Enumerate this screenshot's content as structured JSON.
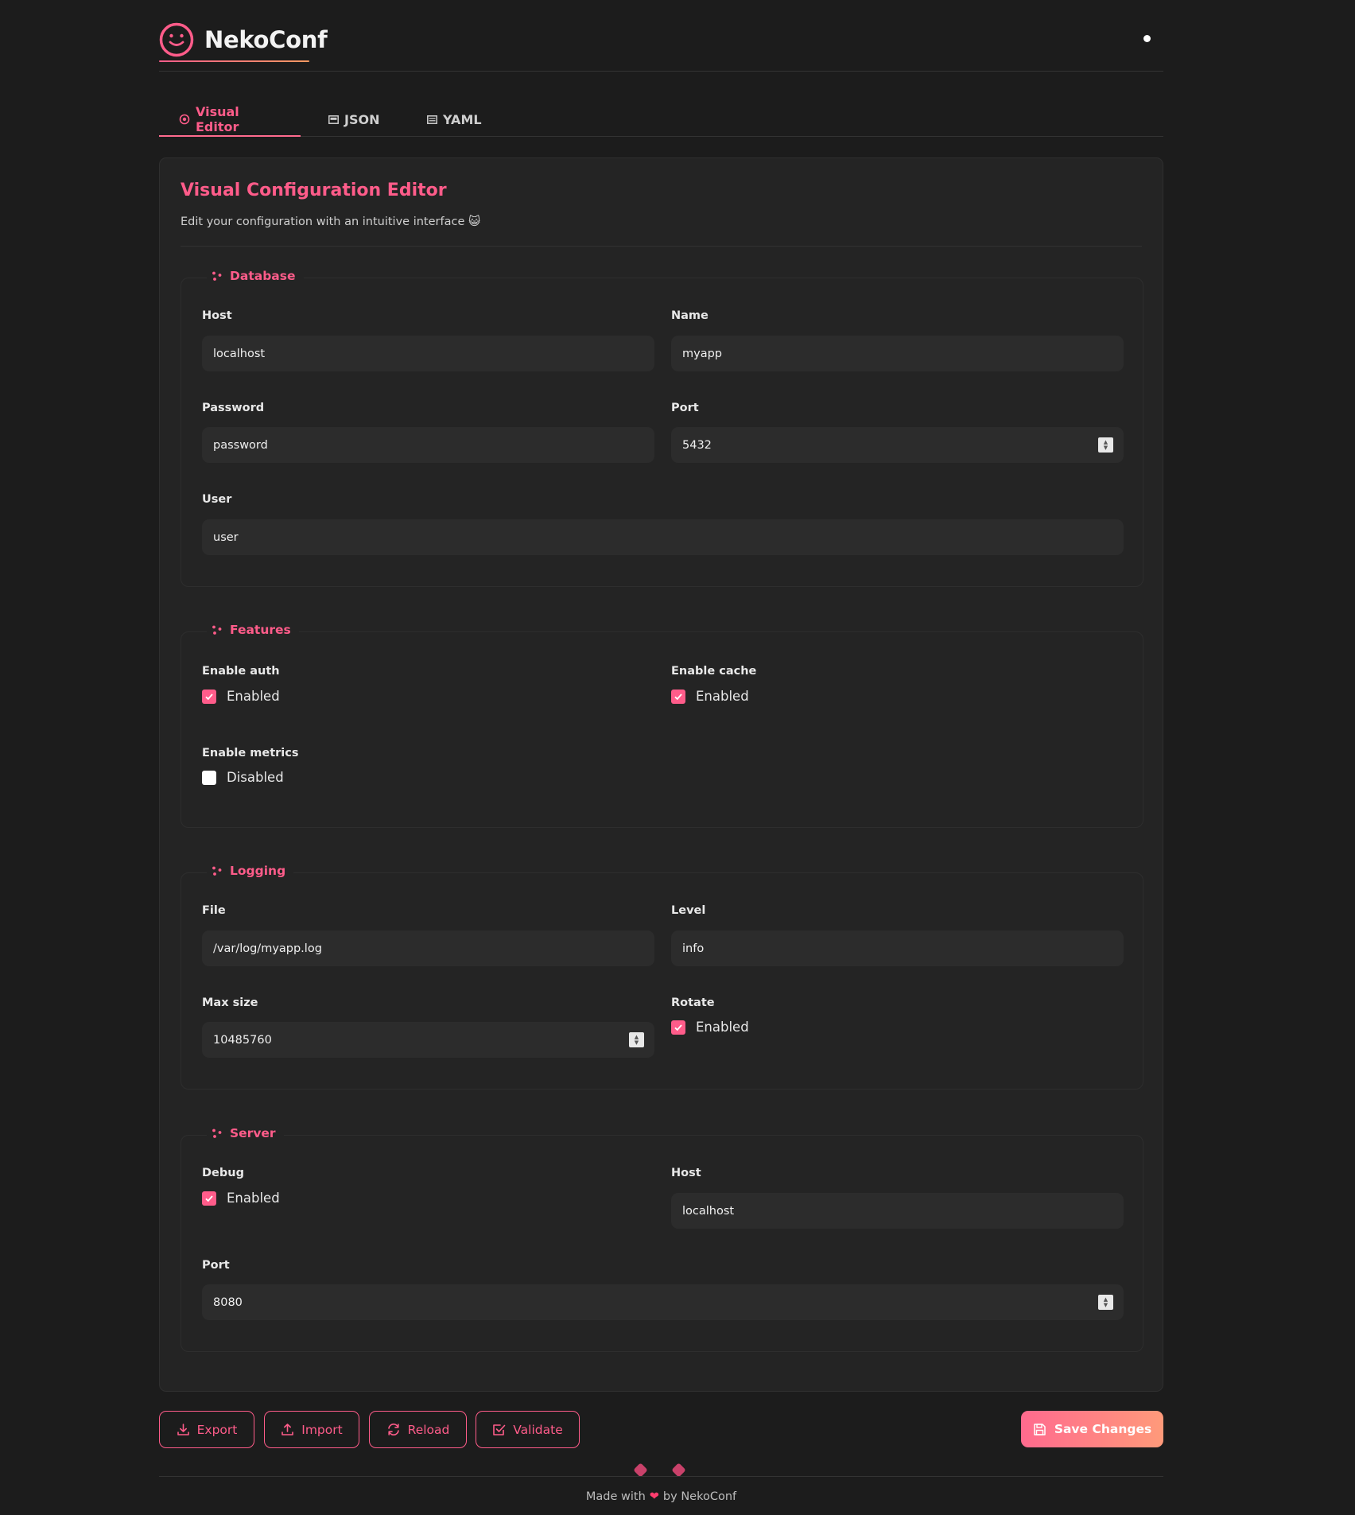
{
  "app": {
    "name": "NekoConf",
    "logo_icon": "cat-face-logo-icon",
    "accent": "#ff5c8a"
  },
  "tabs": [
    {
      "label": "Visual Editor",
      "icon": "target-icon",
      "active": true
    },
    {
      "label": "JSON",
      "icon": "document-icon",
      "active": false
    },
    {
      "label": "YAML",
      "icon": "document-icon",
      "active": false
    }
  ],
  "editor": {
    "title": "Visual Configuration Editor",
    "subtitle": "Edit your configuration with an intuitive interface 😺"
  },
  "sections": {
    "database": {
      "title": "Database",
      "host_label": "Host",
      "host_value": "localhost",
      "name_label": "Name",
      "name_value": "myapp",
      "password_label": "Password",
      "password_value": "password",
      "port_label": "Port",
      "port_value": "5432",
      "user_label": "User",
      "user_value": "user"
    },
    "features": {
      "title": "Features",
      "auth_label": "Enable auth",
      "auth_state": "Enabled",
      "auth_checked": true,
      "cache_label": "Enable cache",
      "cache_state": "Enabled",
      "cache_checked": true,
      "metrics_label": "Enable metrics",
      "metrics_state": "Disabled",
      "metrics_checked": false
    },
    "logging": {
      "title": "Logging",
      "file_label": "File",
      "file_value": "/var/log/myapp.log",
      "level_label": "Level",
      "level_value": "info",
      "max_size_label": "Max size",
      "max_size_value": "10485760",
      "rotate_label": "Rotate",
      "rotate_state": "Enabled",
      "rotate_checked": true
    },
    "server": {
      "title": "Server",
      "debug_label": "Debug",
      "debug_state": "Enabled",
      "debug_checked": true,
      "host_label": "Host",
      "host_value": "localhost",
      "port_label": "Port",
      "port_value": "8080"
    }
  },
  "actions": {
    "export": "Export",
    "import": "Import",
    "reload": "Reload",
    "validate": "Validate",
    "save": "Save Changes"
  },
  "footer": {
    "made_with": "Made with",
    "by": "by NekoConf"
  }
}
